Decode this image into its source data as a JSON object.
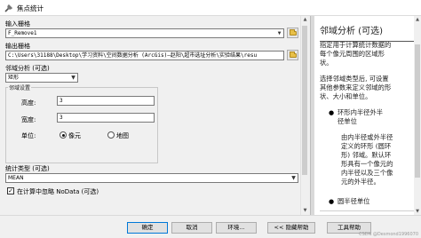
{
  "window": {
    "title": "焦点统计"
  },
  "form": {
    "input_raster": {
      "label": "输入栅格",
      "value": "F_Remove1"
    },
    "output_raster": {
      "label": "输出栅格",
      "value": "C:\\Users\\31188\\Desktop\\学习资料\\空间数据分析 (ArcGis)—赵阳\\超市选址分析\\实验结果\\resu"
    },
    "neighborhood": {
      "label": "邻域分析 (可选)",
      "value": "矩形"
    },
    "settings": {
      "group_title": "邻域设置",
      "height": {
        "label": "高度:",
        "value": "3"
      },
      "width": {
        "label": "宽度:",
        "value": "3"
      },
      "units": {
        "label": "单位:",
        "options": [
          "像元",
          "地图"
        ],
        "selected": "像元"
      }
    },
    "stat_type": {
      "label": "统计类型 (可选)",
      "value": "MEAN"
    },
    "ignore_nodata": {
      "label": "在计算中忽略 NoData (可选)",
      "checked": true
    }
  },
  "help": {
    "heading": "邻域分析 (可选)",
    "para1": [
      "指定用于计算统计数据的",
      "每个像元周围的区域形",
      "状。"
    ],
    "para2": [
      "选择邻域类型后, 可设置",
      "其他参数来定义邻域的形",
      "状、大小和单位。"
    ],
    "items": [
      {
        "title": [
          "环形内半径外半",
          "径单位"
        ],
        "desc": [
          "由内半径或外半径",
          "定义的环形 (圆环",
          "形) 邻域。默认环",
          "形具有一个像元的",
          "内半径以及三个像",
          "元的外半径。"
        ]
      },
      {
        "title": [
          "圆半径单位"
        ],
        "desc": []
      }
    ]
  },
  "footer": {
    "buttons": {
      "ok": "确定",
      "cancel": "取消",
      "env": "环境...",
      "hide_help": "<< 隐藏帮助",
      "tool_help": "工具帮助"
    },
    "watermark": "CSDN @Desmond1996070"
  },
  "icons": [
    "tool-icon",
    "folder-icon",
    "chevron-down-icon",
    "scroll-up-icon",
    "scroll-down-icon"
  ]
}
